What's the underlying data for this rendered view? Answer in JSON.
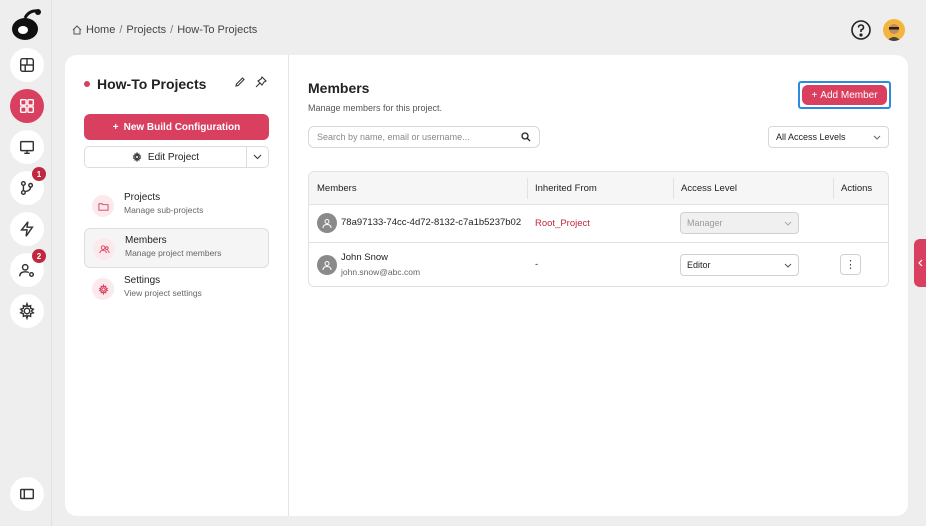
{
  "breadcrumb": {
    "home": "Home",
    "sep1": "/",
    "projects": "Projects",
    "sep2": "/",
    "current": "How-To Projects"
  },
  "rail": {
    "items": [
      {
        "name": "dashboard-icon"
      },
      {
        "name": "projects-icon",
        "active": true
      },
      {
        "name": "monitor-icon"
      },
      {
        "name": "branch-icon",
        "badge": "1"
      },
      {
        "name": "lightning-icon"
      },
      {
        "name": "users-settings-icon",
        "badge": "2"
      },
      {
        "name": "gear-icon"
      }
    ]
  },
  "sidebar": {
    "project_title": "How-To Projects",
    "new_build_label": "New Build Configuration",
    "edit_project_label": "Edit Project",
    "nav": [
      {
        "title": "Projects",
        "subtitle": "Manage sub-projects",
        "icon": "folder-icon"
      },
      {
        "title": "Members",
        "subtitle": "Manage project members",
        "icon": "members-icon",
        "active": true
      },
      {
        "title": "Settings",
        "subtitle": "View project settings",
        "icon": "settings-icon"
      }
    ]
  },
  "main": {
    "title": "Members",
    "subtitle": "Manage members for this project.",
    "add_member_label": "Add Member",
    "search_placeholder": "Search by name, email or username...",
    "access_filter": "All Access Levels",
    "table": {
      "headers": [
        "Members",
        "Inherited From",
        "Access Level",
        "Actions"
      ],
      "rows": [
        {
          "member": "78a97133-74cc-4d72-8132-c7a1b5237b02",
          "email": "",
          "inherited": "Root_Project",
          "access": "Manager",
          "access_disabled": true
        },
        {
          "member": "John Snow",
          "email": "john.snow@abc.com",
          "inherited": "-",
          "access": "Editor",
          "access_disabled": false,
          "action": "⋮"
        }
      ]
    }
  },
  "colors": {
    "accent": "#d93f5f",
    "focus": "#2a8be0"
  }
}
